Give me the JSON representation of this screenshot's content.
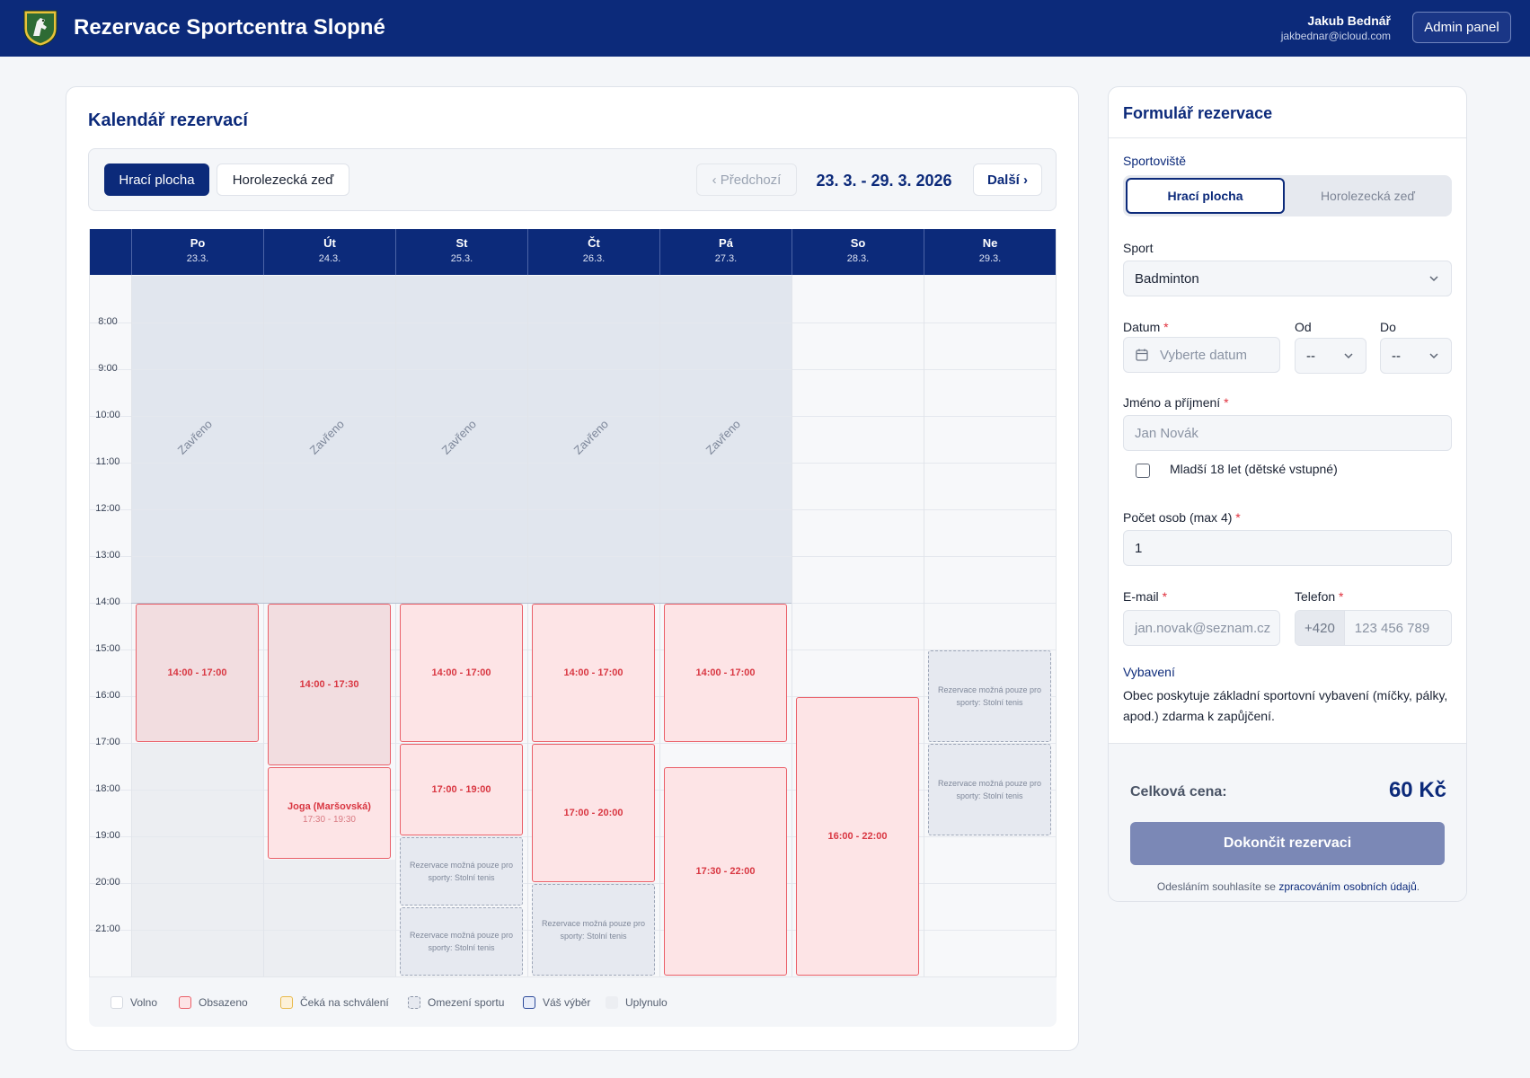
{
  "header": {
    "title": "Rezervace Sportcentra Slopné",
    "user_name": "Jakub Bednář",
    "user_email": "jakbednar@icloud.com",
    "admin_label": "Admin panel"
  },
  "calendar": {
    "title": "Kalendář rezervací",
    "tabs": [
      {
        "label": "Hrací plocha",
        "active": true
      },
      {
        "label": "Horolezecká zeď",
        "active": false
      }
    ],
    "prev_label": "‹ Předchozí",
    "next_label": "Další ›",
    "week_range": "23. 3. - 29. 3. 2026",
    "days": [
      {
        "day": "Po",
        "date": "23.3."
      },
      {
        "day": "Út",
        "date": "24.3."
      },
      {
        "day": "St",
        "date": "25.3."
      },
      {
        "day": "Čt",
        "date": "26.3."
      },
      {
        "day": "Pá",
        "date": "27.3."
      },
      {
        "day": "So",
        "date": "28.3."
      },
      {
        "day": "Ne",
        "date": "29.3."
      }
    ],
    "hours": [
      "8:00",
      "9:00",
      "10:00",
      "11:00",
      "12:00",
      "13:00",
      "14:00",
      "15:00",
      "16:00",
      "17:00",
      "18:00",
      "19:00",
      "20:00",
      "21:00"
    ],
    "closed_label": "Zavřeno",
    "restriction_text": "Rezervace možná pouze pro sporty: Stolní tenis",
    "bookings": [
      {
        "day": 0,
        "start": 14,
        "end": 17,
        "label": "14:00 - 17:00"
      },
      {
        "day": 1,
        "start": 14,
        "end": 17.5,
        "label": "14:00 - 17:30"
      },
      {
        "day": 1,
        "start": 17.5,
        "end": 19.5,
        "label": "Joga (Maršovská)",
        "sub": "17:30 - 19:30"
      },
      {
        "day": 2,
        "start": 14,
        "end": 17,
        "label": "14:00 - 17:00"
      },
      {
        "day": 2,
        "start": 17,
        "end": 19,
        "label": "17:00 - 19:00"
      },
      {
        "day": 3,
        "start": 14,
        "end": 17,
        "label": "14:00 - 17:00"
      },
      {
        "day": 3,
        "start": 17,
        "end": 20,
        "label": "17:00 - 20:00"
      },
      {
        "day": 4,
        "start": 14,
        "end": 17,
        "label": "14:00 - 17:00"
      },
      {
        "day": 4,
        "start": 17.5,
        "end": 22,
        "label": "17:30 - 22:00"
      },
      {
        "day": 5,
        "start": 16,
        "end": 22,
        "label": "16:00 - 22:00"
      }
    ],
    "restrictions": [
      {
        "day": 2,
        "start": 19,
        "end": 20.5
      },
      {
        "day": 2,
        "start": 20.5,
        "end": 22
      },
      {
        "day": 3,
        "start": 20,
        "end": 22
      },
      {
        "day": 6,
        "start": 15,
        "end": 17
      },
      {
        "day": 6,
        "start": 17,
        "end": 19
      }
    ],
    "legend": [
      {
        "label": "Volno",
        "color": "#ffffff",
        "border": "#d5d9e0",
        "dashed": false
      },
      {
        "label": "Obsazeno",
        "color": "#fde4e6",
        "border": "#ea5f68",
        "dashed": false
      },
      {
        "label": "Čeká na schválení",
        "color": "#fdf1d8",
        "border": "#e8b94a",
        "dashed": false
      },
      {
        "label": "Omezení sportu",
        "color": "#e6e9f0",
        "border": "#8b94a6",
        "dashed": true
      },
      {
        "label": "Váš výběr",
        "color": "#e8edf9",
        "border": "#2c4a9a",
        "dashed": false
      },
      {
        "label": "Uplynulo",
        "color": "#eceef2",
        "border": "#eceef2",
        "dashed": false
      }
    ]
  },
  "form": {
    "title": "Formulář rezervace",
    "venue_label": "Sportoviště",
    "venue_options": [
      "Hrací plocha",
      "Horolezecká zeď"
    ],
    "sport_label": "Sport",
    "sport_value": "Badminton",
    "date_label": "Datum",
    "date_placeholder": "Vyberte datum",
    "from_label": "Od",
    "from_value": "--",
    "to_label": "Do",
    "to_value": "--",
    "name_label": "Jméno a příjmení",
    "name_placeholder": "Jan Novák",
    "child_label": "Mladší 18 let (dětské vstupné)",
    "persons_label": "Počet osob (max 4)",
    "persons_value": "1",
    "email_label": "E-mail",
    "email_placeholder": "jan.novak@seznam.cz",
    "phone_label": "Telefon",
    "phone_prefix": "+420",
    "phone_placeholder": "123 456 789",
    "required_mark": "*",
    "equipment_title": "Vybavení",
    "equipment_text": "Obec poskytuje základní sportovní vybavení (míčky, pálky, apod.) zdarma k zapůjčení.",
    "price_label": "Celková cena:",
    "price_value": "60 Kč",
    "submit_label": "Dokončit rezervaci",
    "consent_prefix": "Odesláním souhlasíte se ",
    "consent_link": "zpracováním osobních údajů",
    "consent_suffix": "."
  }
}
